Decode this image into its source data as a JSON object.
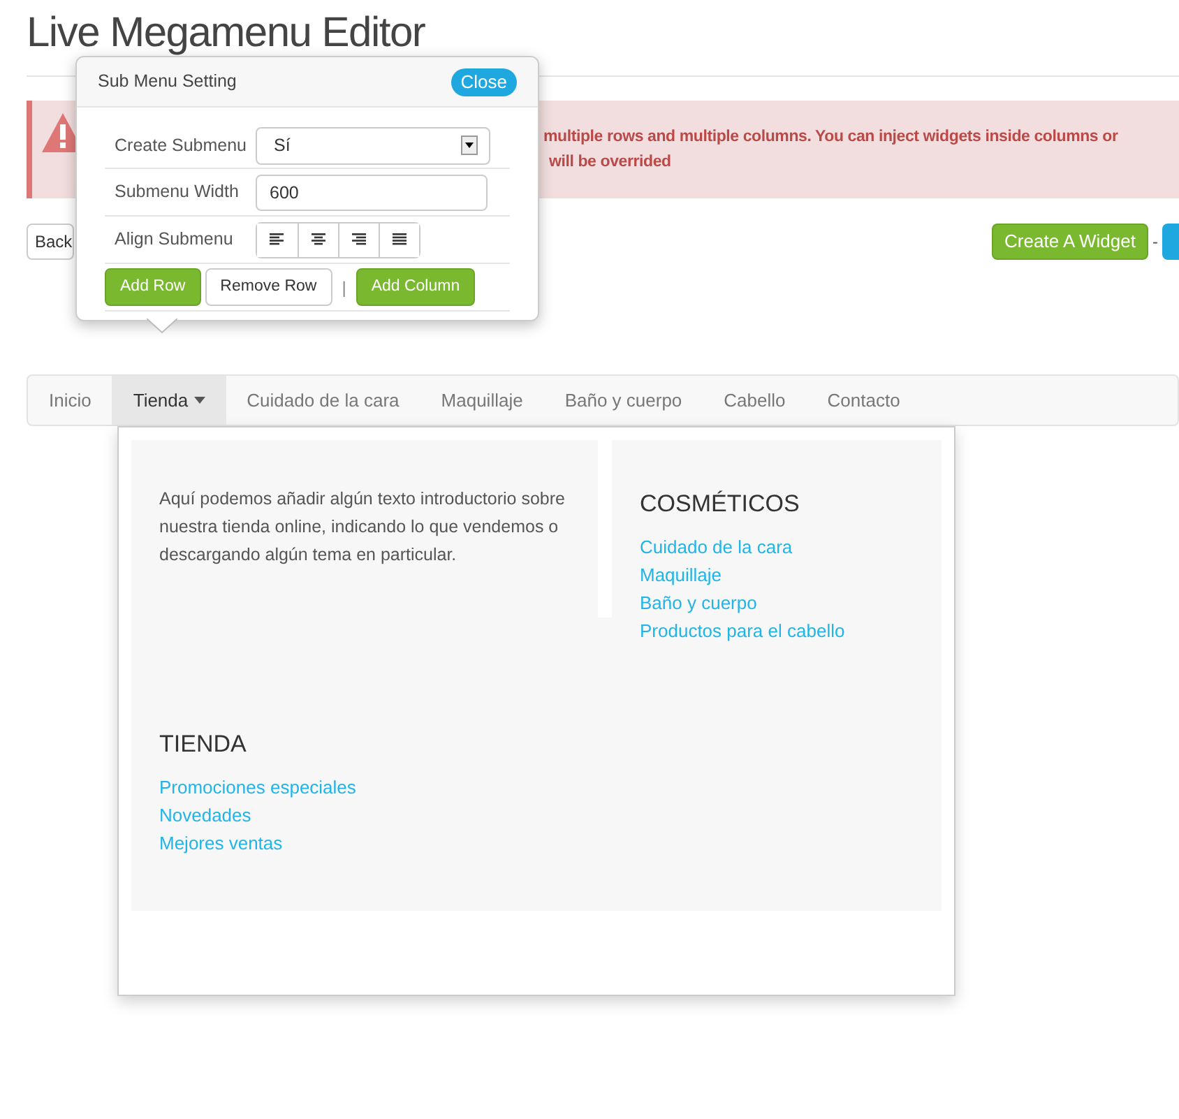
{
  "title": "Live Megamenu Editor",
  "alert": {
    "lines": [
      "multiple rows and multiple columns. You can inject widgets inside columns or",
      "will be overrided"
    ]
  },
  "toolbar": {
    "back": "Back",
    "create_widget": "Create A Widget",
    "separator": "-"
  },
  "popover": {
    "title": "Sub Menu Setting",
    "close": "Close",
    "create_submenu": {
      "label": "Create Submenu",
      "value": "Sí"
    },
    "submenu_width": {
      "label": "Submenu Width",
      "value": "600"
    },
    "align": {
      "label": "Align Submenu",
      "options": [
        {
          "kind": "left",
          "selected": false
        },
        {
          "kind": "center",
          "selected": false
        },
        {
          "kind": "right",
          "selected": false
        },
        {
          "kind": "justify",
          "selected": false
        }
      ]
    },
    "buttons": [
      {
        "label": "Add Row",
        "kind": "primary"
      },
      {
        "label": "Remove Row",
        "kind": "default"
      },
      {
        "label": "|",
        "kind": "divider"
      },
      {
        "label": "Add Column",
        "kind": "primary"
      }
    ]
  },
  "nav": [
    {
      "label": "Inicio",
      "selected": false,
      "caret": false
    },
    {
      "label": "Tienda",
      "selected": true,
      "caret": true
    },
    {
      "label": "Cuidado de la cara",
      "selected": false,
      "caret": false
    },
    {
      "label": "Maquillaje",
      "selected": false,
      "caret": false
    },
    {
      "label": "Baño y cuerpo",
      "selected": false,
      "caret": false
    },
    {
      "label": "Cabello",
      "selected": false,
      "caret": false
    },
    {
      "label": "Contacto",
      "selected": false,
      "caret": false
    }
  ],
  "submenu": {
    "intro": "Aquí podemos añadir algún texto introductorio sobre nuestra tienda online, indicando lo que vendemos o descargando algún tema en particular.",
    "cosmeticos": {
      "heading": "COSMÉTICOS",
      "links": [
        "Cuidado de la cara",
        "Maquillaje",
        "Baño y cuerpo",
        "Productos para el cabello"
      ]
    },
    "tienda": {
      "heading": "TIENDA",
      "links": [
        "Promociones especiales",
        "Novedades",
        "Mejores ventas"
      ]
    }
  }
}
